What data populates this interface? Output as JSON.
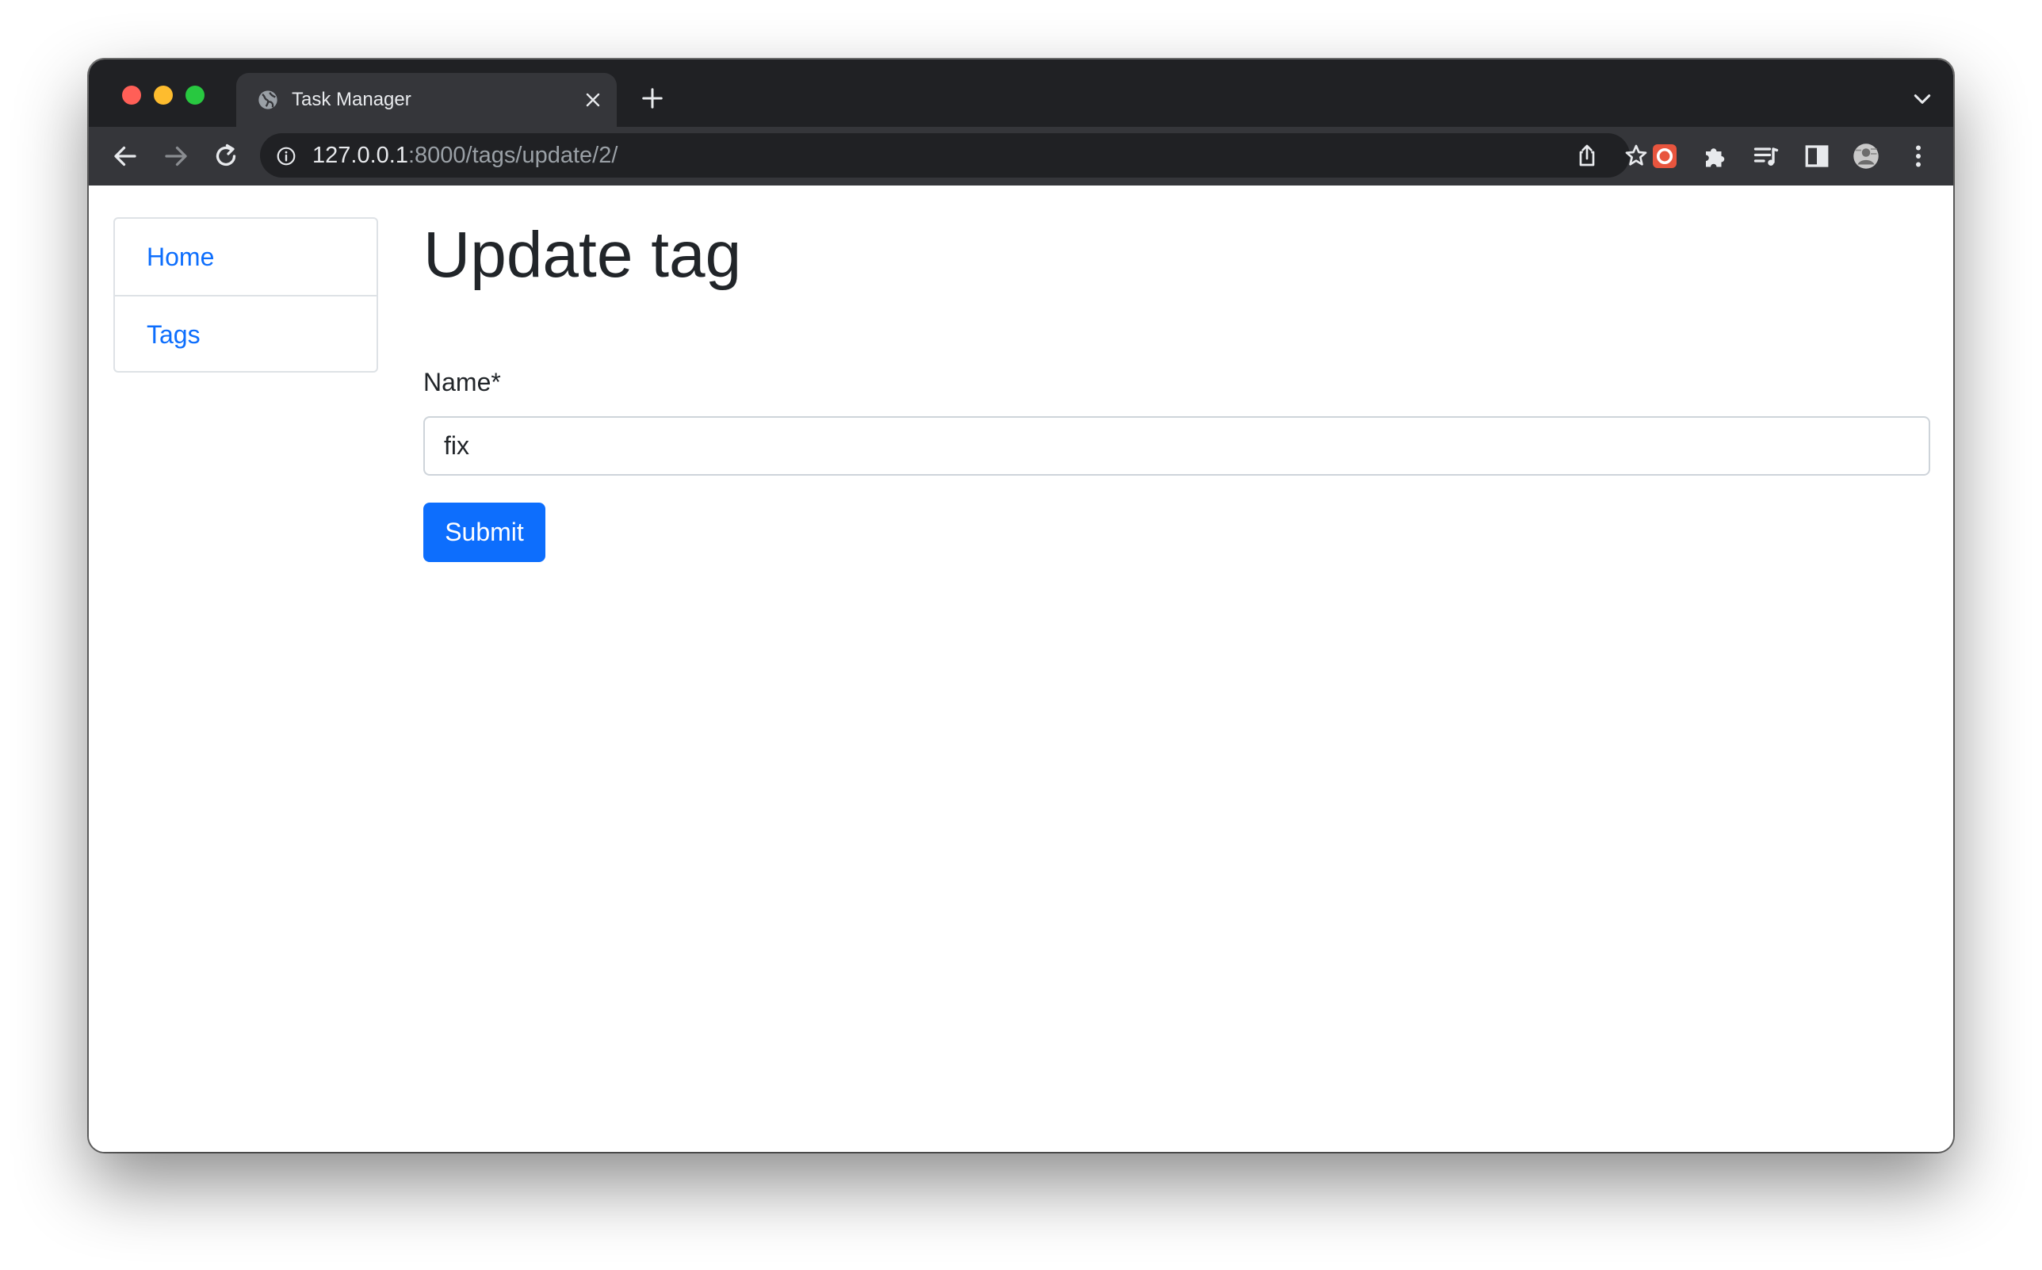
{
  "browser": {
    "tab": {
      "title": "Task Manager",
      "favicon": "globe-icon"
    },
    "address_bar": {
      "url_host": "127.0.0.1",
      "url_path": ":8000/tags/update/2/"
    },
    "toolbar_icons": [
      "back-icon",
      "forward-icon",
      "reload-icon",
      "info-icon",
      "share-icon",
      "star-icon",
      "extension-red-icon",
      "puzzle-icon",
      "media-queue-icon",
      "side-panel-icon",
      "profile-avatar",
      "more-icon"
    ]
  },
  "sidebar": {
    "items": [
      {
        "label": "Home"
      },
      {
        "label": "Tags"
      }
    ]
  },
  "main": {
    "title": "Update tag",
    "form": {
      "name_label": "Name*",
      "name_value": "fix",
      "submit_label": "Submit"
    }
  },
  "colors": {
    "link": "#0d6efd",
    "primary_button": "#0d6efd",
    "browser_dark": "#202124",
    "browser_toolbar": "#35363a"
  }
}
